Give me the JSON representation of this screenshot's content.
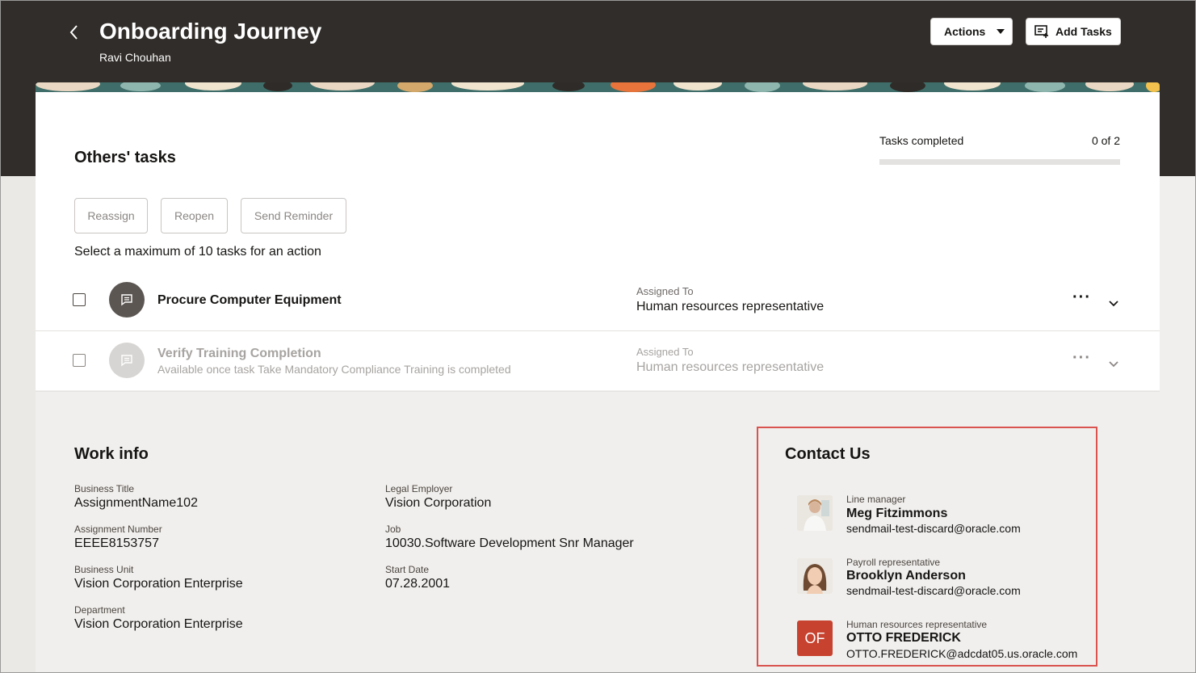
{
  "header": {
    "title": "Onboarding Journey",
    "subtitle": "Ravi Chouhan",
    "actions_label": "Actions",
    "add_tasks_label": "Add Tasks"
  },
  "tasks_section": {
    "title": "Others' tasks",
    "tasks_completed_label": "Tasks completed",
    "tasks_completed_value": "0 of 2",
    "progress_fraction": 0,
    "buttons": [
      "Reassign",
      "Reopen",
      "Send Reminder"
    ],
    "hint": "Select a maximum of 10 tasks for an action",
    "assigned_label": "Assigned To",
    "tasks": [
      {
        "name": "Procure Computer Equipment",
        "subtitle": "",
        "assigned_to": "Human resources representative",
        "enabled": true
      },
      {
        "name": "Verify Training Completion",
        "subtitle": "Available once task Take Mandatory Compliance Training is completed",
        "assigned_to": "Human resources representative",
        "enabled": false
      }
    ]
  },
  "work_info": {
    "title": "Work info",
    "fields": {
      "business_title": {
        "label": "Business Title",
        "value": "AssignmentName102"
      },
      "assignment_number": {
        "label": "Assignment Number",
        "value": "EEEE8153757"
      },
      "business_unit": {
        "label": "Business Unit",
        "value": "Vision Corporation Enterprise"
      },
      "department": {
        "label": "Department",
        "value": "Vision Corporation Enterprise"
      },
      "legal_employer": {
        "label": "Legal Employer",
        "value": "Vision Corporation"
      },
      "job": {
        "label": "Job",
        "value": "10030.Software Development Snr Manager"
      },
      "start_date": {
        "label": "Start Date",
        "value": "07.28.2001"
      }
    }
  },
  "contact_us": {
    "title": "Contact Us",
    "contacts": [
      {
        "role": "Line manager",
        "name": "Meg Fitzimmons",
        "email": "sendmail-test-discard@oracle.com",
        "avatar": "photo"
      },
      {
        "role": "Payroll representative",
        "name": "Brooklyn Anderson",
        "email": "sendmail-test-discard@oracle.com",
        "avatar": "photo"
      },
      {
        "role": "Human resources representative",
        "name": "OTTO FREDERICK",
        "email": "OTTO.FREDERICK@adcdat05.us.oracle.com",
        "avatar": "OF"
      }
    ]
  },
  "colors": {
    "header_bg": "#312d2a",
    "highlight_border": "#d9534f",
    "initials_bg": "#c7422f"
  }
}
